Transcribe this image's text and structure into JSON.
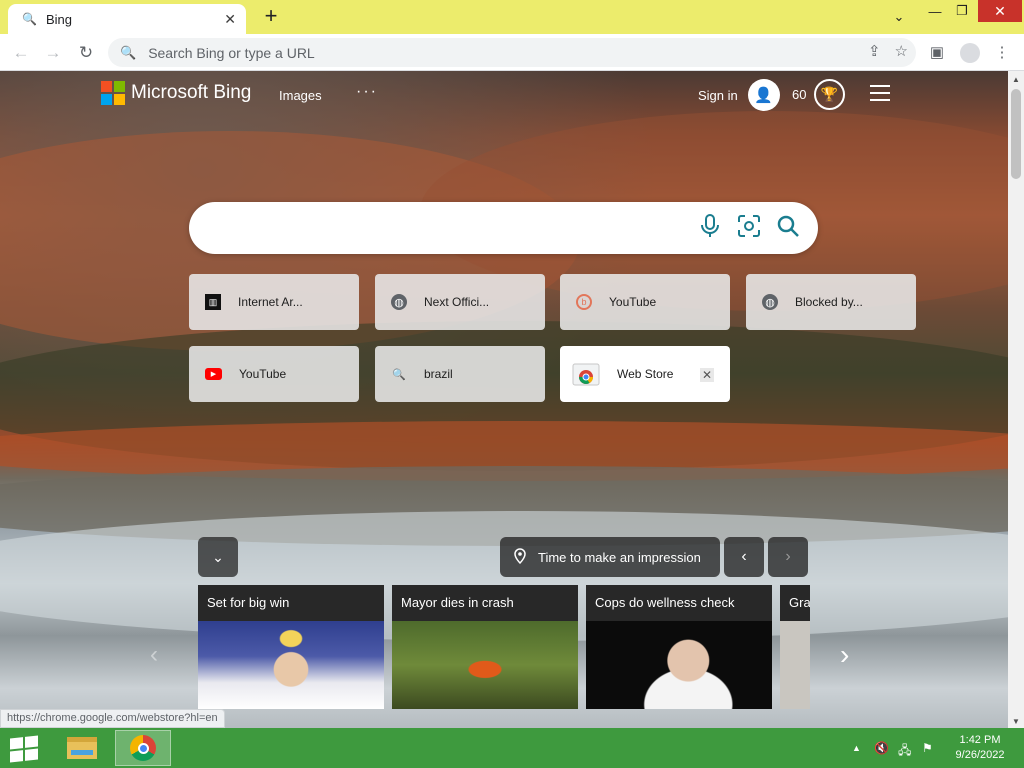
{
  "browser": {
    "tab_title": "Bing",
    "new_tab_glyph": "+",
    "omnibox_placeholder": "Search Bing or type a URL",
    "status_url": "https://chrome.google.com/webstore?hl=en"
  },
  "bing": {
    "logo_text": "Microsoft Bing",
    "nav_images": "Images",
    "nav_more": "···",
    "sign_in": "Sign in",
    "points": "60"
  },
  "shortcuts": [
    {
      "label": "Internet Ar...",
      "icon": "archive-icon"
    },
    {
      "label": "Next Offici...",
      "icon": "globe-icon"
    },
    {
      "label": "YouTube",
      "icon": "bing-icon"
    },
    {
      "label": "Blocked by...",
      "icon": "globe-icon"
    },
    {
      "label": "YouTube",
      "icon": "youtube-icon"
    },
    {
      "label": "brazil",
      "icon": "search-icon"
    },
    {
      "label": "Web Store",
      "icon": "chrome-store-icon"
    }
  ],
  "image_caption": "Time to make an impression",
  "news": [
    {
      "headline": "Set for big win"
    },
    {
      "headline": "Mayor dies in crash"
    },
    {
      "headline": "Cops do wellness check"
    },
    {
      "headline": "Gra"
    }
  ],
  "taskbar": {
    "time": "1:42 PM",
    "date": "9/26/2022"
  },
  "colors": {
    "titlebar": "#ecec6c",
    "taskbar": "#3e9a3e",
    "bing_icon_teal": "#1a7d8f",
    "close_button": "#c8322a"
  }
}
